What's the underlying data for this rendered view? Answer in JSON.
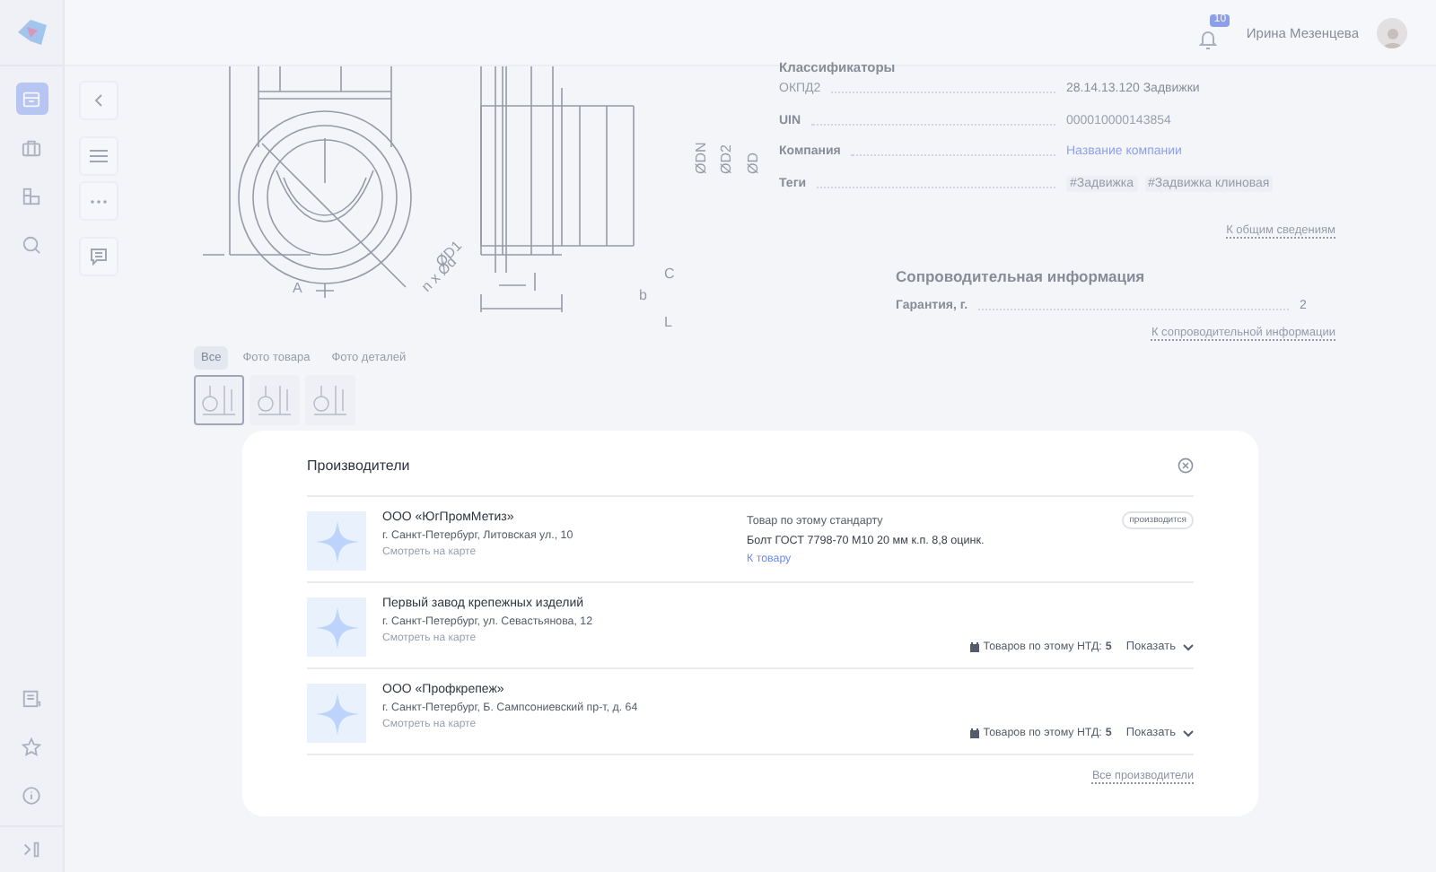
{
  "header": {
    "notifications": "10",
    "user_name": "Ирина Мезенцева"
  },
  "sidebar": {
    "items": [
      {
        "selected": true
      },
      {
        "selected": false
      },
      {
        "selected": false
      },
      {
        "selected": false
      }
    ]
  },
  "drawing": {
    "labels": [
      "A",
      "ØD1",
      "n x Ød",
      "ØDN",
      "ØD2",
      "ØD",
      "C",
      "b",
      "L"
    ]
  },
  "gallery": {
    "tabs": [
      {
        "label": "Все",
        "selected": true
      },
      {
        "label": "Фото товара",
        "selected": false
      },
      {
        "label": "Фото деталей",
        "selected": false
      }
    ],
    "thumbnails": [
      {
        "selected": true
      },
      {
        "selected": false
      },
      {
        "selected": false
      }
    ]
  },
  "details": {
    "heading": "Классификаторы",
    "rows": [
      {
        "label": "ОКПД2",
        "value": "28.14.13.120 Задвижки",
        "kind": "text"
      },
      {
        "label": "UIN",
        "value": "000010000143854",
        "kind": "muted"
      },
      {
        "label": "Компания",
        "value": "Название компании",
        "kind": "link"
      },
      {
        "label": "Теги",
        "tags": [
          "#Задвижка",
          "#Задвижка клиновая"
        ],
        "kind": "tags"
      }
    ],
    "link": "К общим сведениям"
  },
  "accompanying": {
    "title": "Сопроводительная информация",
    "rows": [
      {
        "label": "Гарантия, г.",
        "value": "2"
      }
    ],
    "link": "К сопроводительной информации"
  },
  "modal": {
    "title": "Производители",
    "manufacturers": [
      {
        "name": "ООО «ЮгПромМетиз»",
        "address": "г. Санкт-Петербург, Литовская ул., 10",
        "map_link": "Смотреть на карте",
        "kind": "product",
        "product": {
          "heading": "Товар по этому стандарту",
          "badge": "производится",
          "name": "Болт ГОСТ 7798-70 М10 20 мм к.п. 8,8 оцинк.",
          "link": "К товару"
        }
      },
      {
        "name": "Первый завод крепежных изделий",
        "address": "г. Санкт-Петербург, ул. Севастьянова, 12",
        "map_link": "Смотреть на карте",
        "kind": "count",
        "count_label": "Товаров по этому НТД:",
        "count": "5",
        "toggle": "Показать",
        "expanded": false
      },
      {
        "name": "ООО «Профкрепеж»",
        "address": "г. Санкт-Петербург, Б. Сампсониевский пр-т, д. 64",
        "map_link": "Смотреть на карте",
        "kind": "count",
        "count_label": "Товаров по этому НТД:",
        "count": "5",
        "toggle": "Показать",
        "expanded": false
      }
    ],
    "all_link": "Все производители"
  }
}
